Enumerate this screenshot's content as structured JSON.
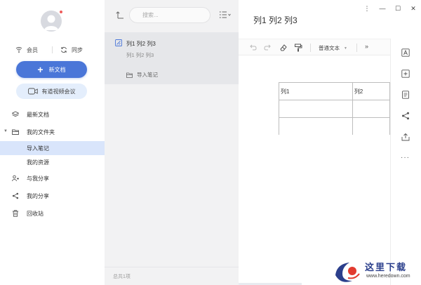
{
  "sidebar": {
    "account": {
      "member_label": "会员",
      "sync_label": "同步"
    },
    "new_doc_label": "新文档",
    "meeting_label": "有道视频会议",
    "nav": {
      "recent": "最新文档",
      "my_folder": "我的文件夹",
      "import_notes": "导入笔记",
      "my_resources": "我的资源",
      "shared_with_me": "与我分享",
      "my_shares": "我的分享",
      "recycle_bin": "回收站"
    }
  },
  "list": {
    "search_placeholder": "搜索...",
    "note": {
      "title": "列1 列2 列3",
      "summary": "列1 列2 列3",
      "folder": "导入笔记"
    },
    "footer": "总共1项"
  },
  "editor": {
    "title": "列1 列2 列3",
    "toolbar": {
      "paragraph_style": "普通文本",
      "more": "»"
    },
    "table": {
      "headers": [
        "列1",
        "列2"
      ],
      "rows": [
        [
          "",
          ""
        ],
        [
          "",
          ""
        ]
      ]
    },
    "side_more": "···"
  },
  "window": {
    "menu": "⋮",
    "minimize": "—",
    "maximize": "☐",
    "close": "✕"
  },
  "watermark": {
    "text": "这里下载",
    "url": "www.heredown.com"
  },
  "colors": {
    "accent": "#4a76d8",
    "active_bg": "#d9e5fb",
    "list_bg": "#f2f2f3"
  }
}
